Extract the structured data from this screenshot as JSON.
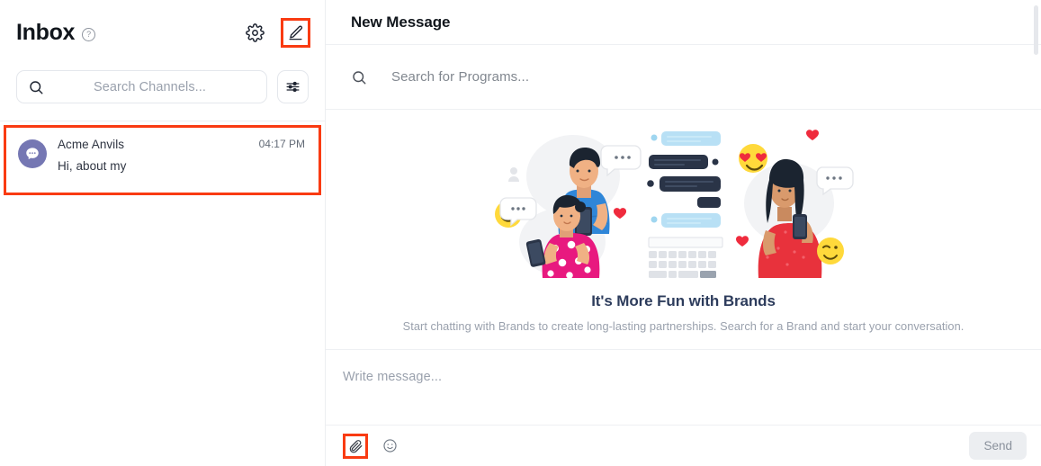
{
  "sidebar": {
    "title": "Inbox",
    "help_icon": "question-mark-circle-icon",
    "settings_icon": "gear-icon",
    "compose_icon": "pencil-compose-icon",
    "search": {
      "icon": "search-icon",
      "placeholder": "Search Channels..."
    },
    "filter_icon": "sliders-filter-icon",
    "conversations": [
      {
        "avatar_icon": "chat-bubble-icon",
        "avatar_color": "#7577b3",
        "name": "Acme Anvils",
        "time": "04:17 PM",
        "preview": "Hi, about my",
        "highlighted": true
      }
    ]
  },
  "main": {
    "title": "New Message",
    "program_search": {
      "icon": "search-icon",
      "placeholder": "Search for Programs..."
    },
    "empty_state": {
      "illustration": "people-chatting-illustration",
      "title": "It's More Fun with Brands",
      "subtitle": "Start chatting with Brands to create long-lasting partnerships. Search for a Brand and start your conversation."
    },
    "composer": {
      "placeholder": "Write message...",
      "attach_icon": "paperclip-icon",
      "emoji_icon": "smiley-face-icon",
      "send_label": "Send"
    }
  },
  "highlight_color": "#f93b12"
}
